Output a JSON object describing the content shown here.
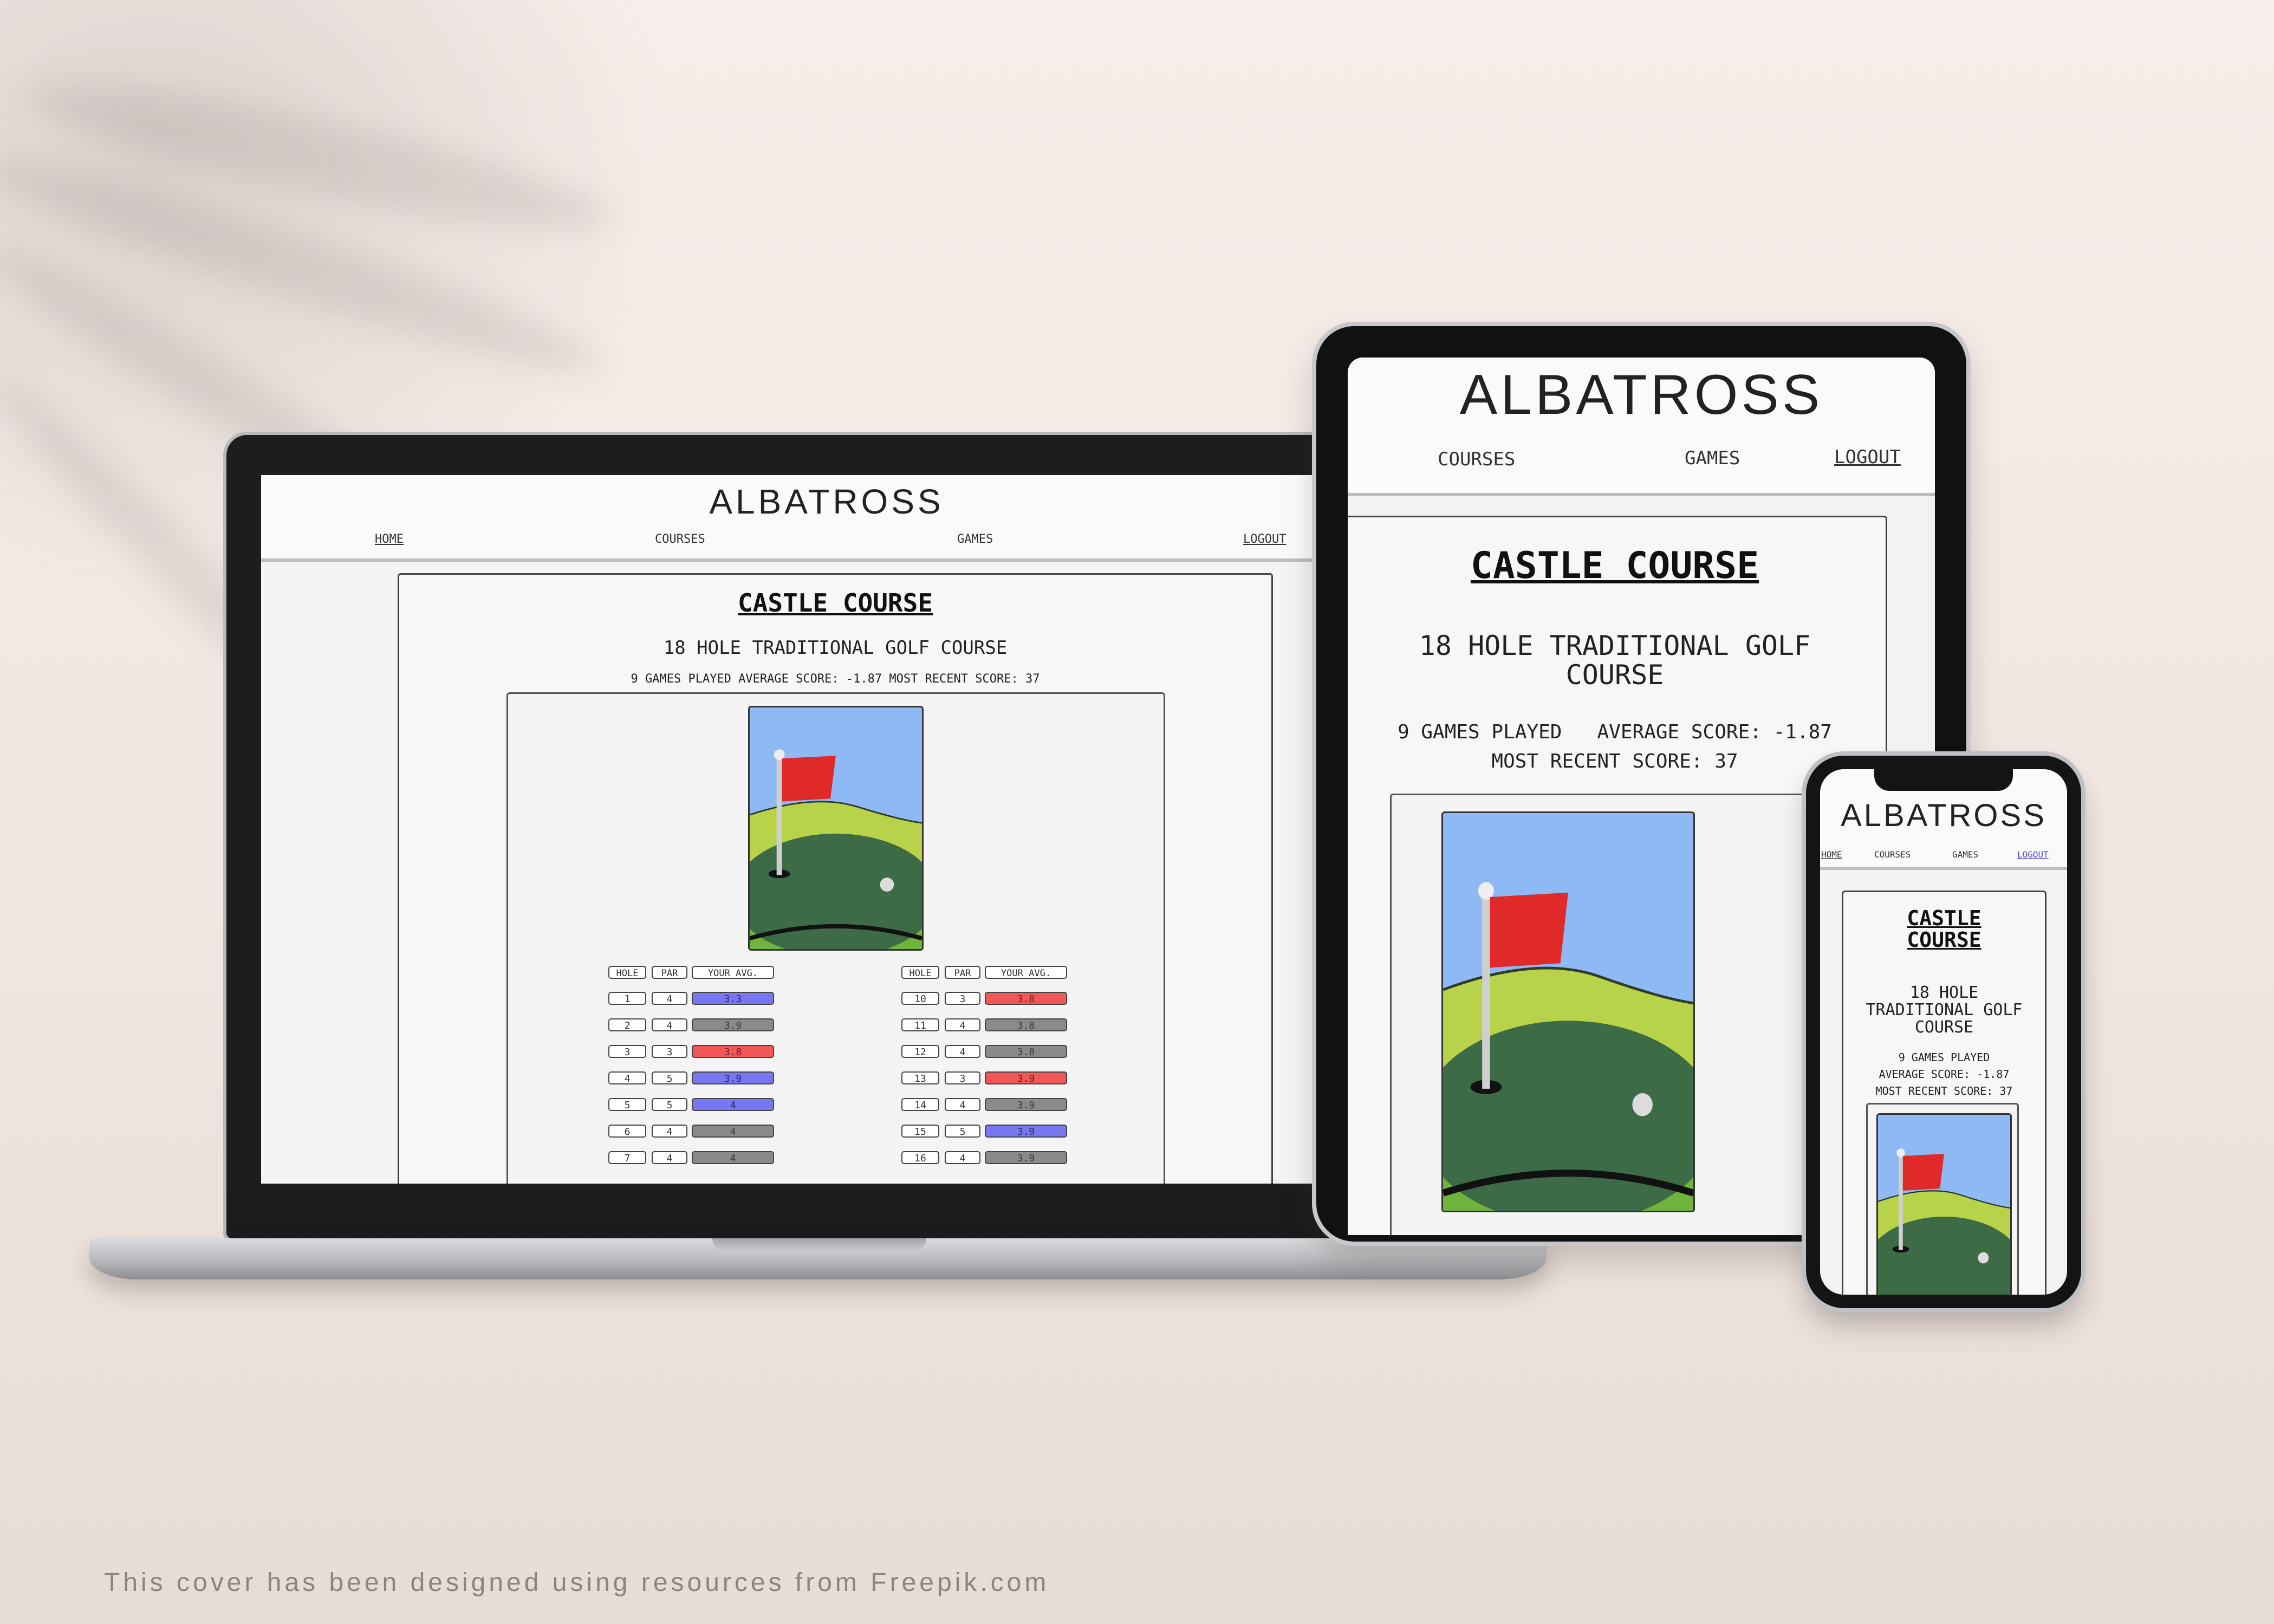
{
  "app": {
    "logo": "ALBATROSS"
  },
  "nav": {
    "home": "Home",
    "courses": "Courses",
    "games": "Games",
    "logout": "Logout"
  },
  "course": {
    "title": "Castle Course",
    "subtitle": "18 Hole Traditional Golf Course",
    "games_played": "9 Games Played",
    "average_score": "Average Score: -1.87",
    "recent_score": "Most Recent Score: 37"
  },
  "table": {
    "headers": [
      "Hole",
      "Par",
      "Your Avg."
    ],
    "left_rows": [
      {
        "hole": "1",
        "par": "4",
        "avg": "3.3",
        "status": "blue"
      },
      {
        "hole": "2",
        "par": "4",
        "avg": "3.9",
        "status": "gray"
      },
      {
        "hole": "3",
        "par": "3",
        "avg": "3.8",
        "status": "red"
      },
      {
        "hole": "4",
        "par": "5",
        "avg": "3.9",
        "status": "blue"
      },
      {
        "hole": "5",
        "par": "5",
        "avg": "4",
        "status": "blue"
      },
      {
        "hole": "6",
        "par": "4",
        "avg": "4",
        "status": "gray"
      },
      {
        "hole": "7",
        "par": "4",
        "avg": "4",
        "status": "gray"
      }
    ],
    "right_rows": [
      {
        "hole": "10",
        "par": "3",
        "avg": "3.8",
        "status": "red"
      },
      {
        "hole": "11",
        "par": "4",
        "avg": "3.8",
        "status": "gray"
      },
      {
        "hole": "12",
        "par": "4",
        "avg": "3.8",
        "status": "gray"
      },
      {
        "hole": "13",
        "par": "3",
        "avg": "3.9",
        "status": "red"
      },
      {
        "hole": "14",
        "par": "4",
        "avg": "3.9",
        "status": "gray"
      },
      {
        "hole": "15",
        "par": "5",
        "avg": "3.9",
        "status": "blue"
      },
      {
        "hole": "16",
        "par": "4",
        "avg": "3.9",
        "status": "gray"
      }
    ]
  },
  "colors": {
    "under_par": "#7777f2",
    "at_par": "#8a8a8a",
    "over_par": "#f25757",
    "sky": "#8fb9f5",
    "flag": "#e02a2a",
    "green_dark": "#3c6b45",
    "green_light": "#b8d24a"
  },
  "credit": "This cover has been designed using resources from Freepik.com"
}
